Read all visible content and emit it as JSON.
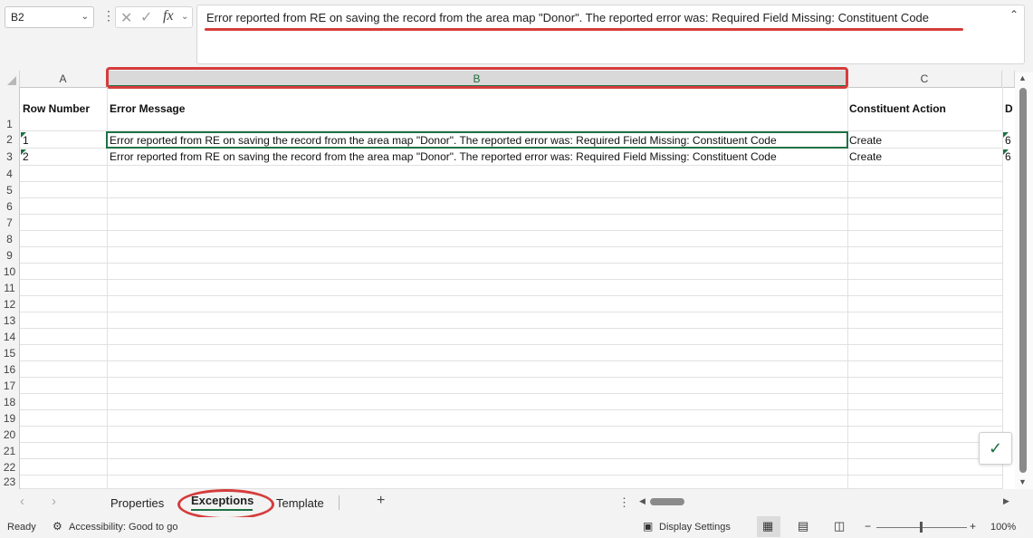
{
  "formula_bar": {
    "name_box": "B2",
    "fx": "fx",
    "formula": "Error reported from RE on saving the record from the area map \"Donor\". The reported error was: Required Field Missing:  Constituent Code"
  },
  "columns": [
    {
      "letter": "A"
    },
    {
      "letter": "B",
      "selected": true
    },
    {
      "letter": "C"
    }
  ],
  "header_row": {
    "row_number": "Row Number",
    "error_message": "Error Message",
    "constituent_action": "Constituent Action",
    "partial_col_d": "D"
  },
  "data_rows": [
    {
      "row_number": "1",
      "error_message": "Error reported from RE on saving the record from the area map \"Donor\". The reported error was: Required Field Missing:  Constituent Code",
      "constituent_action": "Create",
      "col_d": "6"
    },
    {
      "row_number": "2",
      "error_message": "Error reported from RE on saving the record from the area map \"Donor\". The reported error was: Required Field Missing:  Constituent Code",
      "constituent_action": "Create",
      "col_d": "6"
    }
  ],
  "row_numbers": [
    "1",
    "2",
    "3",
    "4",
    "5",
    "6",
    "7",
    "8",
    "9",
    "10",
    "11",
    "12",
    "13",
    "14",
    "15",
    "16",
    "17",
    "18",
    "19",
    "20",
    "21",
    "22",
    "23"
  ],
  "sheet_tabs": [
    {
      "label": "Properties",
      "active": false
    },
    {
      "label": "Exceptions",
      "active": true
    },
    {
      "label": "Template",
      "active": false
    }
  ],
  "add_sheet": "+",
  "status_bar": {
    "ready": "Ready",
    "accessibility": "Accessibility: Good to go",
    "display_settings": "Display Settings",
    "zoom_out": "−",
    "zoom_in": "+",
    "zoom": "100%"
  },
  "colors": {
    "accent": "#1e7145",
    "highlight_ring": "#d53c3c"
  }
}
